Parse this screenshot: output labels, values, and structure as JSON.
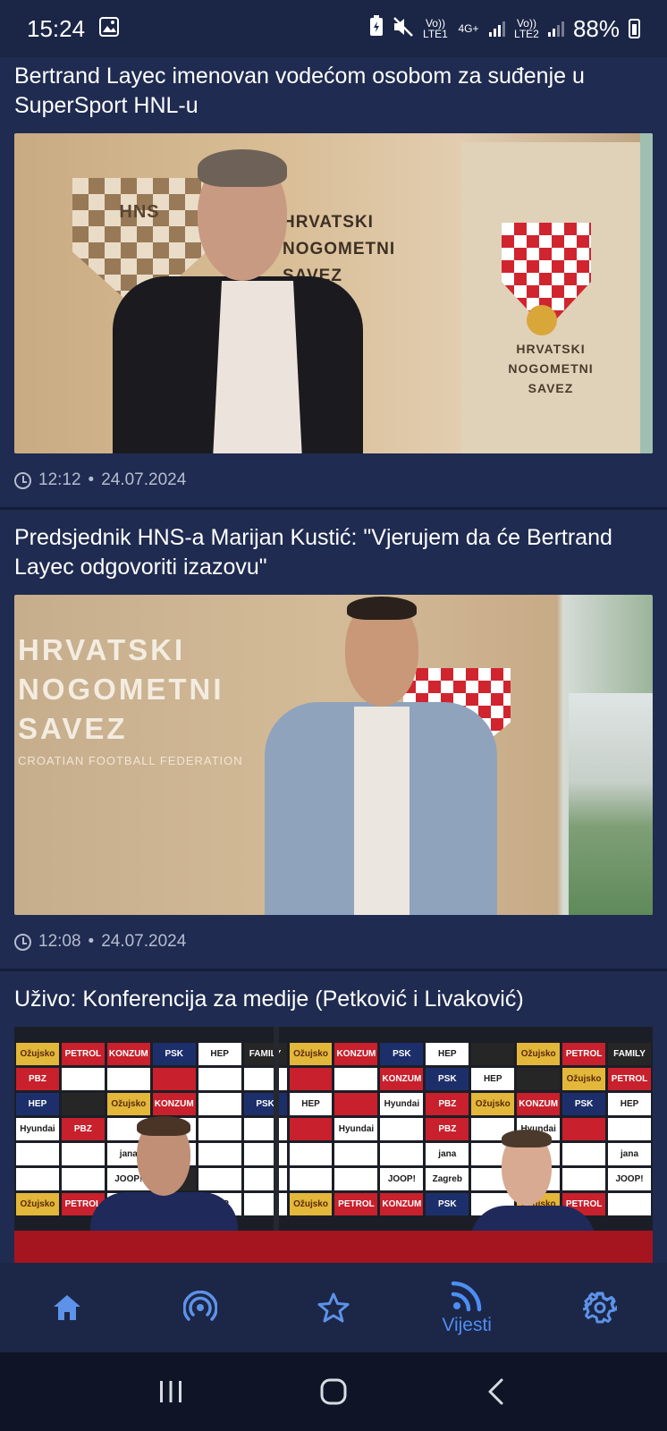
{
  "status_bar": {
    "time": "15:24",
    "lte1": "Vo)) LTE1",
    "net": "4G+",
    "lte2": "Vo)) LTE2",
    "battery": "88%"
  },
  "feed": {
    "articles": [
      {
        "title": "Bertrand Layec imenovan vodećom osobom za suđenje u SuperSport HNL-u",
        "time": "12:12",
        "date": "24.07.2024",
        "image_text": [
          "HNS",
          "HRVATSKI",
          "NOGOMETNI",
          "SAVEZ"
        ]
      },
      {
        "title": "Predsjednik HNS-a Marijan Kustić: \"Vjerujem da će Bertrand Layec odgovoriti izazovu\"",
        "time": "12:08",
        "date": "24.07.2024",
        "image_text": [
          "HRVATSKI",
          "NOGOMETNI",
          "SAVEZ",
          "CROATIAN FOOTBALL FEDERATION"
        ]
      },
      {
        "title": "Uživo: Konferencija za medije (Petković i Livaković)",
        "image_sponsors": [
          "Ožujsko",
          "PETROL",
          "KONZUM",
          "PSK",
          "HEP",
          "PBZ",
          "Hyundai",
          "jana",
          "JOOP!",
          "Zagreb",
          "FAMILY"
        ]
      }
    ]
  },
  "bottom_nav": {
    "items": [
      {
        "icon": "home-icon",
        "label": ""
      },
      {
        "icon": "live-broadcast-icon",
        "label": ""
      },
      {
        "icon": "star-icon",
        "label": ""
      },
      {
        "icon": "rss-feed-icon",
        "label": "Vijesti",
        "active": true
      },
      {
        "icon": "gear-icon",
        "label": ""
      }
    ],
    "active_color": "#4d8ef5",
    "inactive_color": "#5d92e8"
  },
  "system_nav": {
    "buttons": [
      "recent-apps",
      "home",
      "back"
    ]
  }
}
